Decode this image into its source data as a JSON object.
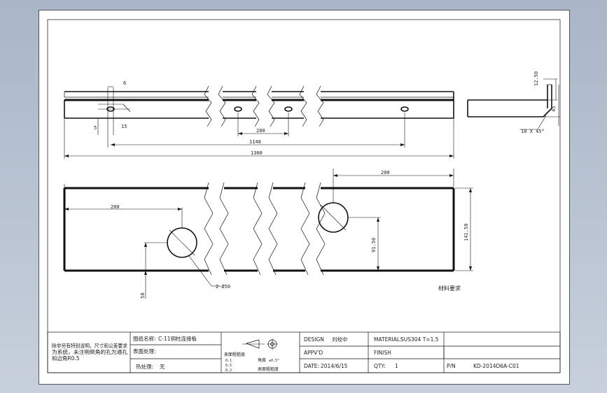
{
  "dimensions": {
    "d_6": "6",
    "d_5": "5",
    "d_15": "15",
    "d_280": "280",
    "d_1140": "1140",
    "d_1300": "1300",
    "d_200_top": "200",
    "d_200_left": "200",
    "d_141_50": "141.50",
    "d_91_50": "91.50",
    "d_50": "50",
    "d_2_dia_50": "2-Ø50",
    "d_12_50": "12.50",
    "d_45": "45",
    "d_chamfer": "10 X 45°"
  },
  "notes": {
    "material_requirement": "材料要求"
  },
  "title_block": {
    "tech_note_line1": "除非另有特别说明，尺寸和公差要求",
    "tech_note_line2": "为系统，未注明倒角的孔为通孔",
    "tech_note_line3": "和边角R0.5",
    "part_name_label": "图纸名称:",
    "part_name_value": "C-11铜柱连接板",
    "surface_label": "表面处理:",
    "surface_value": "",
    "heat_label": "热处理:",
    "heat_value": "无",
    "roughness_label": "表面粗糙度",
    "roughness_a": "0.1",
    "roughness_b": "0.5",
    "roughness_c": "0.2",
    "precision_label": "角度",
    "precision_value": "±0.5°",
    "design_label": "DESIGN",
    "design_value": "刘校中",
    "appvd_label": "APPV'D",
    "date_label": "DATE:",
    "date_value": "2014/6/15",
    "material_label": "MATERIAL:",
    "material_value": "SUS304 T=1.5",
    "finish_label": "FINISH",
    "qty_label": "QTY:",
    "qty_value": "1",
    "pn_label": "P/N",
    "pn_value": "KD-2014D6A-C01"
  }
}
